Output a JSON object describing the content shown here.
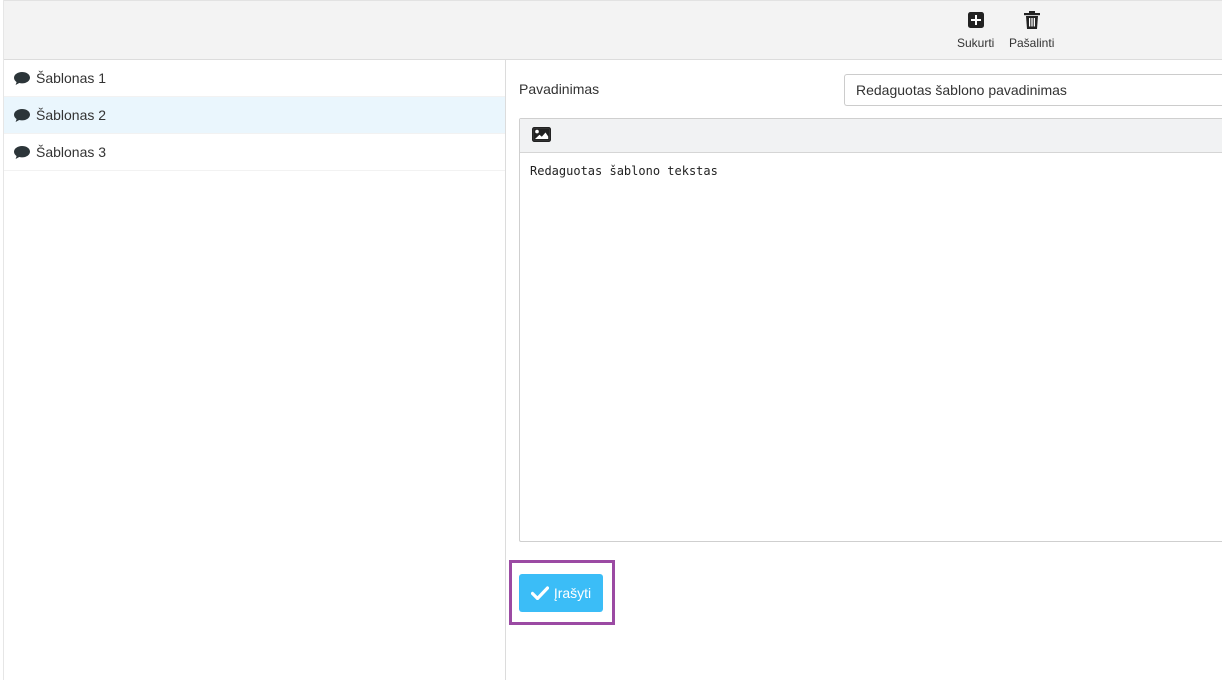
{
  "templates": [
    {
      "label": "Šablonas 1",
      "icon": "comment-icon",
      "active": false
    },
    {
      "label": "Šablonas 2",
      "icon": "comment-icon",
      "active": true
    },
    {
      "label": "Šablonas 3",
      "icon": "comment-icon",
      "active": false
    }
  ],
  "toolbar": {
    "create_label": "Sukurti",
    "delete_label": "Pašalinti",
    "create_icon": "plus-square-icon",
    "delete_icon": "trash-icon"
  },
  "form": {
    "name_label": "Pavadinimas",
    "name_value": "Redaguotas šablono pavadinimas",
    "editor_toolbar_icon": "image-icon",
    "body_text": "Redaguotas šablono tekstas",
    "save_label": "Įrašyti",
    "save_icon": "checkmark-icon"
  },
  "colors": {
    "active_row": "#eaf6fd",
    "save_button": "#3bbdf7",
    "highlight_border": "#9b4aa3"
  }
}
